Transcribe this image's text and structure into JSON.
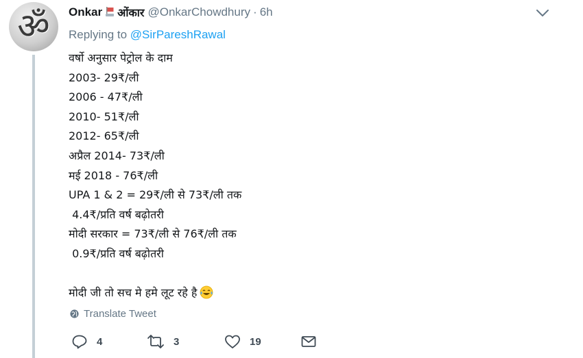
{
  "tweet": {
    "author": {
      "name": "Onkar",
      "name_suffix": "ओंकार",
      "handle": "@OnkarChowdhury",
      "time": "6h",
      "separator": "·",
      "avatar_glyph": "ॐ"
    },
    "replying_prefix": "Replying to",
    "replying_to": "@SirPareshRawal",
    "lines": [
      "वर्षो अनुसार पेट्रोल के दाम",
      "2003- 29₹/ली",
      "2006 - 47₹/ली",
      "2010- 51₹/ली",
      "2012- 65₹/ली",
      "अप्रैल 2014- 73₹/ली",
      "मई 2018 - 76₹/ली",
      "UPA 1 & 2 = 29₹/ली से 73₹/ली तक",
      " 4.4₹/प्रति वर्ष बढ़ोतरी",
      "मोदी सरकार = 73₹/ली से 76₹/ली तक",
      " 0.9₹/प्रति वर्ष बढ़ोतरी",
      "",
      "मोदी जी तो सच मे हमे लूट रहे है"
    ],
    "last_line_emoji": "face-with-tears-of-joy",
    "translate_label": "Translate Tweet",
    "actions": {
      "reply_count": "4",
      "retweet_count": "3",
      "like_count": "19"
    }
  },
  "icons": {
    "caret": "chevron-down-icon",
    "translate": "globe-icon",
    "reply": "reply-icon",
    "retweet": "retweet-icon",
    "like": "heart-icon",
    "dm": "envelope-icon",
    "name_badge": "flag-badge-icon"
  },
  "colors": {
    "link": "#1da1f2",
    "secondary_text": "#657786",
    "thread_line": "#c4cfd6",
    "icon": "#3f4a54"
  }
}
